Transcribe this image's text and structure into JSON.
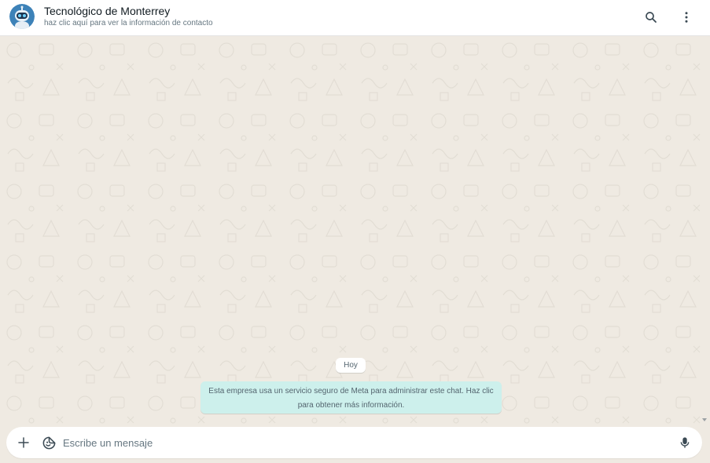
{
  "header": {
    "contact_name": "Tecnológico de Monterrey",
    "subtitle": "haz clic aquí para ver la información de contacto",
    "icons": [
      "robot-avatar",
      "search-icon",
      "more-vertical-icon"
    ]
  },
  "chat": {
    "date_chip": "Hoy",
    "system_message": "Esta empresa usa un servicio seguro de Meta para administrar este chat. Haz clic para obtener más información."
  },
  "composer": {
    "placeholder": "Escribe un mensaje",
    "icons": [
      "plus-icon",
      "sticker-icon",
      "microphone-icon"
    ]
  },
  "colors": {
    "background": "#efeae2",
    "system_bubble": "#cdf0ec",
    "icon": "#3b4a54",
    "header": "#ffffff"
  }
}
